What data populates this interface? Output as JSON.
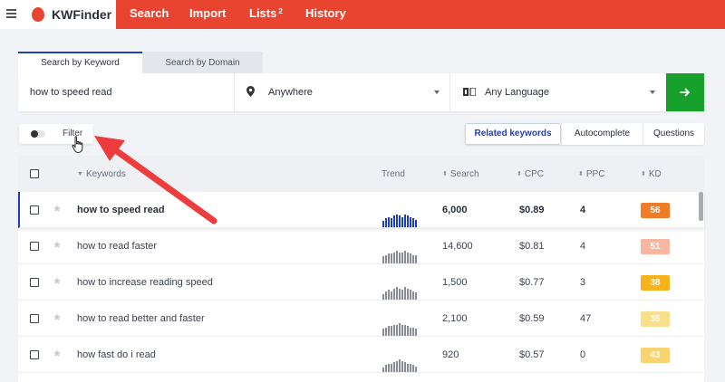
{
  "app": {
    "name": "KWFinder"
  },
  "nav": [
    {
      "label": "Search",
      "badge": ""
    },
    {
      "label": "Import",
      "badge": ""
    },
    {
      "label": "Lists",
      "badge": "2"
    },
    {
      "label": "History",
      "badge": ""
    }
  ],
  "search": {
    "tabs": [
      {
        "label": "Search by Keyword",
        "active": true
      },
      {
        "label": "Search by Domain",
        "active": false
      }
    ],
    "keyword_value": "how to speed read",
    "location": "Anywhere",
    "language": "Any Language"
  },
  "filter": {
    "label": "Filter"
  },
  "keyword_types": [
    {
      "label": "Related keywords",
      "active": true
    },
    {
      "label": "Autocomplete",
      "active": false
    },
    {
      "label": "Questions",
      "active": false
    }
  ],
  "table": {
    "headers": {
      "keywords": "Keywords",
      "trend": "Trend",
      "search": "Search",
      "cpc": "CPC",
      "ppc": "PPC",
      "kd": "KD"
    },
    "rows": [
      {
        "keyword": "how to speed read",
        "search": "6,000",
        "cpc": "$0.89",
        "ppc": "4",
        "kd": "56",
        "kd_color": "#f07c28",
        "trend": [
          5,
          7,
          8,
          7,
          9,
          10,
          9,
          8,
          10,
          9,
          8,
          7,
          6
        ],
        "trend_color": "#1f3fb8"
      },
      {
        "keyword": "how to read faster",
        "search": "14,600",
        "cpc": "$0.81",
        "ppc": "4",
        "kd": "51",
        "kd_color": "#f7b6a0",
        "trend": [
          5,
          6,
          7,
          7,
          8,
          9,
          8,
          8,
          9,
          8,
          7,
          6,
          6
        ],
        "trend_color": "#888c96"
      },
      {
        "keyword": "how to increase reading speed",
        "search": "1,500",
        "cpc": "$0.77",
        "ppc": "3",
        "kd": "38",
        "kd_color": "#f6b31c",
        "trend": [
          4,
          6,
          7,
          6,
          8,
          9,
          8,
          7,
          9,
          8,
          7,
          6,
          5
        ],
        "trend_color": "#888c96"
      },
      {
        "keyword": "how to read better and faster",
        "search": "2,100",
        "cpc": "$0.59",
        "ppc": "47",
        "kd": "35",
        "kd_color": "#f8df8a",
        "trend": [
          5,
          6,
          7,
          7,
          8,
          8,
          9,
          8,
          8,
          7,
          6,
          6,
          5
        ],
        "trend_color": "#888c96"
      },
      {
        "keyword": "how fast do i read",
        "search": "920",
        "cpc": "$0.57",
        "ppc": "0",
        "kd": "43",
        "kd_color": "#f8d46e",
        "trend": [
          3,
          5,
          6,
          6,
          7,
          8,
          9,
          8,
          7,
          6,
          6,
          5,
          4
        ],
        "trend_color": "#888c96"
      }
    ]
  },
  "colors": {
    "brand": "#e8442f",
    "accent": "#1f3fb8",
    "go": "#17a12c",
    "annotation": "#ee3b3b"
  }
}
